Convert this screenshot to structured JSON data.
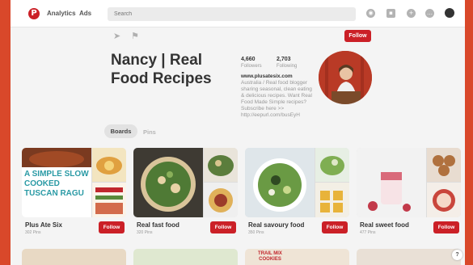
{
  "topbar": {
    "logo": "P",
    "nav": [
      "Analytics",
      "Ads"
    ],
    "search_placeholder": "Search",
    "icons": [
      "compass-icon",
      "briefcase-icon",
      "plus-icon",
      "chat-icon",
      "user-avatar"
    ]
  },
  "profile": {
    "name": "Nancy | Real Food Recipes",
    "follow_label": "Follow",
    "followers_count": "4,660",
    "followers_label": "Followers",
    "following_count": "2,703",
    "following_label": "Following",
    "website": "www.plusatesix.com",
    "bio": "Australia / Real food blogger sharing seasonal, clean eating & delicious recipes. Want Real Food Made Simple recipes? Subscribe here >> http://eepurl.com/busEyH"
  },
  "tabs": {
    "boards": "Boards",
    "pins": "Pins"
  },
  "boards": [
    {
      "title": "Plus Ate Six",
      "count": "302 Pins",
      "follow": "Follow",
      "cover_text": "A SIMPLE SLOW COOKED TUSCAN RAGU"
    },
    {
      "title": "Real fast food",
      "count": "320 Pins",
      "follow": "Follow"
    },
    {
      "title": "Real savoury food",
      "count": "350 Pins",
      "follow": "Follow"
    },
    {
      "title": "Real sweet food",
      "count": "477 Pins",
      "follow": "Follow"
    }
  ],
  "row2_text": "TRAIL MIX COOKIES",
  "help_label": "?",
  "colors": {
    "brand_red": "#cb2027",
    "backdrop": "#d9482a"
  }
}
